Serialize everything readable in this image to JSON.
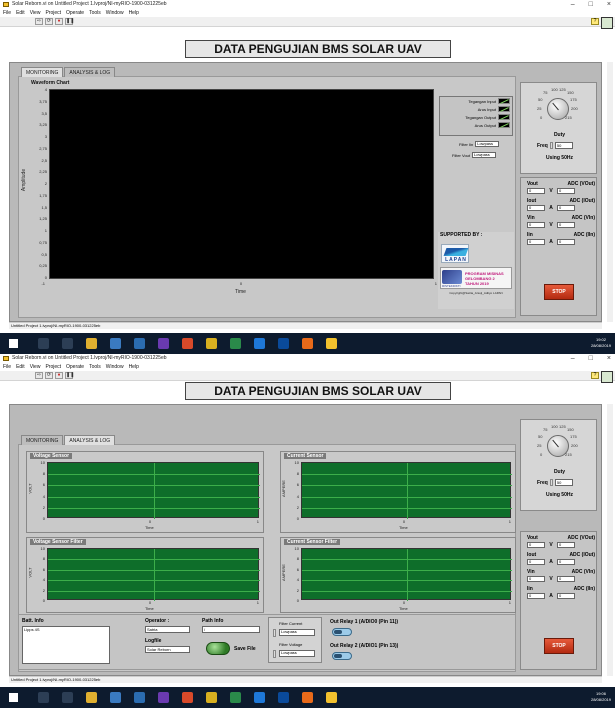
{
  "window": {
    "title": "Solar Reborn.vi on Untitled Project 1.lvproj/NI-myRIO-1900-031225eb",
    "menu": [
      "File",
      "Edit",
      "View",
      "Project",
      "Operate",
      "Tools",
      "Window",
      "Help"
    ],
    "controls": [
      "–",
      "□",
      "×"
    ]
  },
  "header_title": "DATA PENGUJIAN BMS SOLAR UAV",
  "tabs": [
    "MONITORING",
    "ANALYSIS & LOG"
  ],
  "sidebar": {
    "knob_scale": [
      "0",
      "25",
      "50",
      "75",
      "100",
      "125",
      "150",
      "175",
      "200",
      "215"
    ],
    "duty_label": "Duty",
    "freq_label": "Freq",
    "freq_value": "50",
    "using_label": "Using 50Hz",
    "vout_label": "Vout",
    "adc_vout_label": "ADC (VOut)",
    "iout_label": "Iout",
    "adc_iout_label": "ADC (IOut)",
    "vin_label": "Vin",
    "adc_vin_label": "ADC (VIn)",
    "iin_label": "Iin",
    "adc_iin_label": "ADC (IIn)",
    "unit_v": "V",
    "unit_a": "A",
    "zero": "0",
    "stop_label": "STOP"
  },
  "monitoring": {
    "chart_title": "Waveform Chart",
    "y_axis_label": "Amplitude",
    "x_axis_label": "Time",
    "y_ticks": [
      "4",
      "3,75",
      "3,5",
      "3,25",
      "3",
      "2,75",
      "2,5",
      "2,25",
      "2",
      "1,75",
      "1,5",
      "1,25",
      "1",
      "0,75",
      "0,5",
      "0,25",
      "0"
    ],
    "x_ticks": [
      "-1",
      "0",
      "1"
    ],
    "legend": [
      "Tegangan Input",
      "Arus Input",
      "Tegangan Output",
      "Arus Output"
    ],
    "filter_iin_label": "Filter Iin",
    "filter_iin_value": "Lowpass",
    "filter_vout_label": "Filter Vout",
    "filter_vout_value": "Lowpass",
    "supported_by": "SUPPORTED BY :",
    "lapan_text": "LAPAN",
    "ristek_text": "RISTEKDIKTI",
    "program_text": [
      "PROGRAM MISINAS",
      "GELOMBANG 2",
      "TAHUN 2019"
    ],
    "copyright": "Copyright@Satria_Arsuji_Adityo LAPAN"
  },
  "analysis": {
    "voltage_sensor": "Voltage Sensor",
    "current_sensor": "Current Sensor",
    "voltage_sensor_filter": "Voltage Sensor Filter",
    "current_sensor_filter": "Current Sensor Filter",
    "volt_axis": "VOLT",
    "ampere_axis": "AMPERE",
    "time_axis": "Time",
    "y_ticks": [
      "10",
      "8",
      "6",
      "4",
      "2",
      "0"
    ],
    "x_ticks": [
      "0",
      "1"
    ],
    "batt_info_label": "Batt. Info",
    "batt_info_value": "Lipps 4S",
    "operator_label": "Operator :",
    "operator_value": "Satria",
    "path_info_label": "Path Info",
    "path_info_value": "/",
    "logfile_label": "Logfile",
    "logfile_value": "Solar Reborn",
    "save_file_label": "Save File",
    "filter_current_label": "Filter Current",
    "filter_current_value": "Lowpass",
    "filter_voltage_label": "Filter Voltage",
    "filter_voltage_value": "Lowpass",
    "relay1_label": "Out Relay 1 (A/DIO0 (Pin 11))",
    "relay2_label": "Out Relay 2 (A/DIO1 (Pin 13))"
  },
  "statusbar": "Untitled Project 1.lvproj/NI-myRIO-1900-031225eb",
  "taskbar": {
    "time1": "19:02",
    "date1": "28/08/2019",
    "time2": "19:06",
    "date2": "28/08/2019"
  },
  "colors": {
    "panel_gray": "#b9b9b9",
    "plot_black": "#000000",
    "plot_green": "#0e6e2a",
    "stop_red": "#d0401f",
    "taskbar": "#0d1b2e"
  }
}
